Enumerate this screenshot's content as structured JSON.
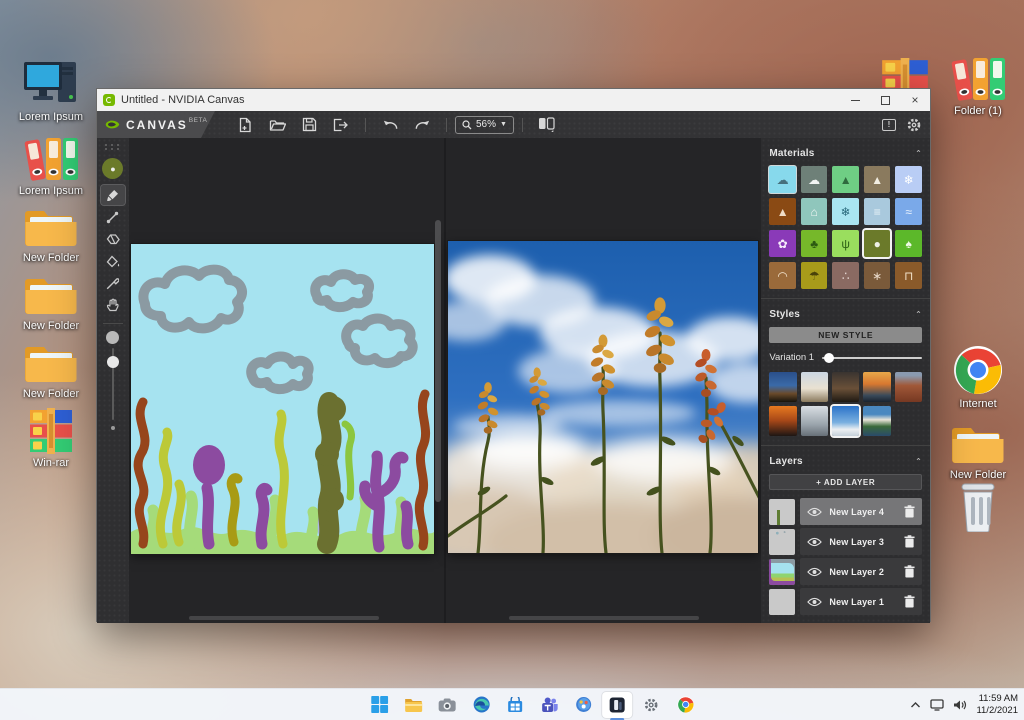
{
  "desktop": {
    "icons_left": [
      {
        "label": "Lorem Ipsum",
        "kind": "computer"
      },
      {
        "label": "Lorem Ipsum",
        "kind": "binders"
      },
      {
        "label": "New Folder",
        "kind": "folder"
      },
      {
        "label": "New Folder",
        "kind": "folder"
      },
      {
        "label": "New Folder",
        "kind": "folder"
      },
      {
        "label": "Win-rar",
        "kind": "winrar"
      }
    ],
    "icons_right": [
      {
        "label": "Folder (1)",
        "kind": "binders"
      },
      {
        "label": "Internet",
        "kind": "chrome"
      },
      {
        "label": "New Folder",
        "kind": "folder"
      },
      {
        "label": "",
        "kind": "recycle-bin"
      }
    ],
    "taskbar": {
      "items": [
        "start",
        "file-explorer",
        "camera",
        "edge",
        "store",
        "teams",
        "paint-3d",
        "nvidia-canvas",
        "settings",
        "chrome"
      ],
      "active_item": "nvidia-canvas"
    },
    "tray": {
      "time": "11:59 AM",
      "date": "11/2/2021"
    }
  },
  "window": {
    "title": "Untitled - NVIDIA Canvas",
    "toolbar": {
      "brand": "CANVAS",
      "beta": "BETA",
      "zoom": "56%"
    },
    "panels": {
      "materials": {
        "title": "Materials",
        "items": [
          {
            "name": "sky",
            "bg": "#87d9ec",
            "glyph": "☁",
            "fg": "#46707c",
            "hl": true
          },
          {
            "name": "clouds",
            "bg": "#6e8078",
            "glyph": "☁",
            "fg": "#f2f5f4"
          },
          {
            "name": "hills",
            "bg": "#6fce84",
            "glyph": "▲",
            "fg": "#2f6a3e"
          },
          {
            "name": "mountain",
            "bg": "#8a7a5e",
            "glyph": "▲",
            "fg": "#f2ede2"
          },
          {
            "name": "snow",
            "bg": "#b9cdf5",
            "glyph": "❄",
            "fg": "#ffffff"
          },
          {
            "name": "dirt",
            "bg": "#8a4a14",
            "glyph": "▲",
            "fg": "#f0ddc8"
          },
          {
            "name": "fog",
            "bg": "#8fc6bc",
            "glyph": "⌂",
            "fg": "#f2f7f5"
          },
          {
            "name": "ice",
            "bg": "#a9e5f1",
            "glyph": "❄",
            "fg": "#2a6a7c"
          },
          {
            "name": "fence",
            "bg": "#a9c9dd",
            "glyph": "≡",
            "fg": "#e9f3f8"
          },
          {
            "name": "water",
            "bg": "#7aa9e9",
            "glyph": "≈",
            "fg": "#eef4fc"
          },
          {
            "name": "flowers",
            "bg": "#8a3ab8",
            "glyph": "✿",
            "fg": "#f6edfb"
          },
          {
            "name": "bush",
            "bg": "#76b82a",
            "glyph": "♣",
            "fg": "#2c5a12"
          },
          {
            "name": "grass",
            "bg": "#9ade5e",
            "glyph": "ψ",
            "fg": "#2f6416"
          },
          {
            "name": "stone",
            "bg": "#6b7a2a",
            "glyph": "●",
            "fg": "#eef0e6",
            "sel": true
          },
          {
            "name": "trees",
            "bg": "#5cb82a",
            "glyph": "♠",
            "fg": "#effae6"
          },
          {
            "name": "sand",
            "bg": "#9a6a3a",
            "glyph": "◠",
            "fg": "#f2e3ce"
          },
          {
            "name": "straw",
            "bg": "#a89b1a",
            "glyph": "☂",
            "fg": "#4a420a"
          },
          {
            "name": "gravel",
            "bg": "#8a6a62",
            "glyph": "∴",
            "fg": "#e8dcd8"
          },
          {
            "name": "rock",
            "bg": "#7a5a3a",
            "glyph": "∗",
            "fg": "#e8d8c8"
          },
          {
            "name": "wood",
            "bg": "#8a5a2a",
            "glyph": "⊓",
            "fg": "#f0e0c8"
          }
        ]
      },
      "styles": {
        "title": "Styles",
        "new_style_label": "NEW STYLE",
        "variation_label": "Variation 1",
        "items": [
          {
            "name": "mountain-dusk",
            "cls": "st1"
          },
          {
            "name": "bright-clouds",
            "cls": "st2"
          },
          {
            "name": "dark-canyon",
            "cls": "st3"
          },
          {
            "name": "sunset-lake",
            "cls": "st4"
          },
          {
            "name": "red-rocks",
            "cls": "st5"
          },
          {
            "name": "orange-sunset",
            "cls": "st6"
          },
          {
            "name": "misty-peaks",
            "cls": "st7"
          },
          {
            "name": "blue-sky-clouds",
            "cls": "st8",
            "sel": true
          },
          {
            "name": "mountain-lake",
            "cls": "st9"
          }
        ]
      },
      "layers": {
        "title": "Layers",
        "add_label": "+ ADD LAYER",
        "items": [
          {
            "name": "New Layer 4",
            "thumb": "lt4",
            "selected": true
          },
          {
            "name": "New Layer 3",
            "thumb": "lt3",
            "selected": false
          },
          {
            "name": "New Layer 2",
            "thumb": "lt2",
            "selected": false
          },
          {
            "name": "New Layer 1",
            "thumb": "lt1",
            "selected": false
          }
        ]
      }
    }
  }
}
